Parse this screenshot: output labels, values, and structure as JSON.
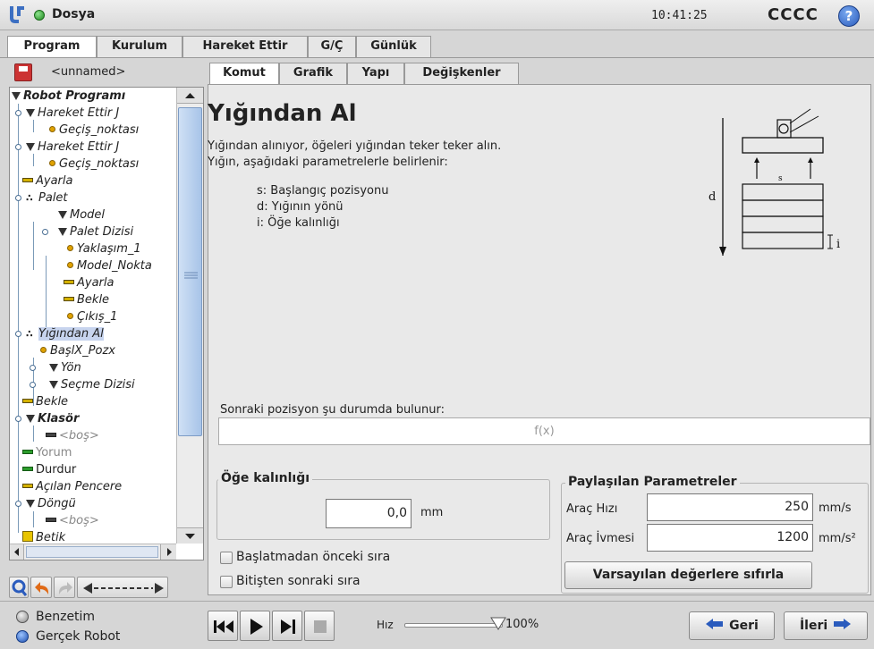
{
  "app": {
    "file_menu": "Dosya",
    "clock": "10:41:25",
    "robot_name": "CCCC",
    "help_glyph": "?"
  },
  "main_tabs": [
    {
      "label": "Program",
      "active": true
    },
    {
      "label": "Kurulum",
      "active": false
    },
    {
      "label": "Hareket Ettir",
      "active": false
    },
    {
      "label": "G/Ç",
      "active": false
    },
    {
      "label": "Günlük",
      "active": false
    }
  ],
  "program": {
    "name": "<unnamed>",
    "tree": [
      {
        "label": "Robot Programı",
        "icon": "triangle-icon"
      },
      {
        "label": "Hareket Ettir J",
        "icon": "triangle-icon"
      },
      {
        "label": "Geçiş_noktası",
        "icon": "waypoint-icon"
      },
      {
        "label": "Hareket Ettir J",
        "icon": "triangle-icon"
      },
      {
        "label": "Geçiş_noktası",
        "icon": "waypoint-icon"
      },
      {
        "label": "Ayarla",
        "icon": "set-icon"
      },
      {
        "label": "Palet",
        "icon": "pallet-icon"
      },
      {
        "label": "Model",
        "icon": "triangle-icon"
      },
      {
        "label": "Palet Dizisi",
        "icon": "triangle-icon"
      },
      {
        "label": "Yaklaşım_1",
        "icon": "waypoint-icon"
      },
      {
        "label": "Model_Nokta",
        "icon": "waypoint-icon"
      },
      {
        "label": "Ayarla",
        "icon": "set-icon"
      },
      {
        "label": "Bekle",
        "icon": "set-icon"
      },
      {
        "label": "Çıkış_1",
        "icon": "waypoint-icon"
      },
      {
        "label": "Yığından Al",
        "icon": "pallet-icon"
      },
      {
        "label": "BaşlX_Pozx",
        "icon": "waypoint-icon"
      },
      {
        "label": "Yön",
        "icon": "triangle-icon"
      },
      {
        "label": "Seçme Dizisi",
        "icon": "triangle-icon"
      },
      {
        "label": "Bekle",
        "icon": "set-icon"
      },
      {
        "label": "Klasör",
        "icon": "triangle-icon"
      },
      {
        "label": "<boş>",
        "icon": "set-icon"
      },
      {
        "label": "Yorum",
        "icon": "comment-icon"
      },
      {
        "label": "Durdur",
        "icon": "halt-icon"
      },
      {
        "label": "Açılan Pencere",
        "icon": "set-icon"
      },
      {
        "label": "Döngü",
        "icon": "triangle-icon"
      },
      {
        "label": "<boş>",
        "icon": "set-icon"
      },
      {
        "label": "Betik",
        "icon": "script-icon"
      }
    ]
  },
  "sub_tabs": [
    {
      "label": "Komut",
      "active": true
    },
    {
      "label": "Grafik",
      "active": false
    },
    {
      "label": "Yapı",
      "active": false
    },
    {
      "label": "Değişkenler",
      "active": false
    }
  ],
  "node": {
    "title": "Yığından Al",
    "desc1": "Yığından alınıyor, öğeleri yığından teker teker alın.",
    "desc2": "Yığın, aşağıdaki parametrelerle belirlenir:",
    "param_s": "s: Başlangıç pozisyonu",
    "param_d": "d: Yığının yönü",
    "param_i": "i: Öğe kalınlığı",
    "diagram_d": "d",
    "diagram_s": "s",
    "diagram_i": "i",
    "next_pos_label": "Sonraki pozisyon şu durumda bulunur:",
    "next_pos_placeholder": "f(x)",
    "thickness_title": "Öğe kalınlığı",
    "thickness_value": "0,0",
    "thickness_unit": "mm",
    "before_start_label": "Başlatmadan önceki sıra",
    "after_end_label": "Bitişten sonraki sıra",
    "shared_title": "Paylaşılan Parametreler",
    "tool_speed_label": "Araç Hızı",
    "tool_speed_value": "250",
    "tool_speed_unit": "mm/s",
    "tool_accel_label": "Araç İvmesi",
    "tool_accel_value": "1200",
    "tool_accel_unit": "mm/s²",
    "reset_label": "Varsayılan değerlere sıfırla"
  },
  "bottom": {
    "simulation_label": "Benzetim",
    "real_robot_label": "Gerçek Robot",
    "speed_label": "Hız",
    "speed_value": "100%",
    "speed_fraction": 1.0,
    "back_label": "Geri",
    "next_label": "İleri"
  },
  "colors": {
    "accent": "#1d3f85",
    "selection": "#c7d4ee",
    "running": "#1d8a1d"
  }
}
